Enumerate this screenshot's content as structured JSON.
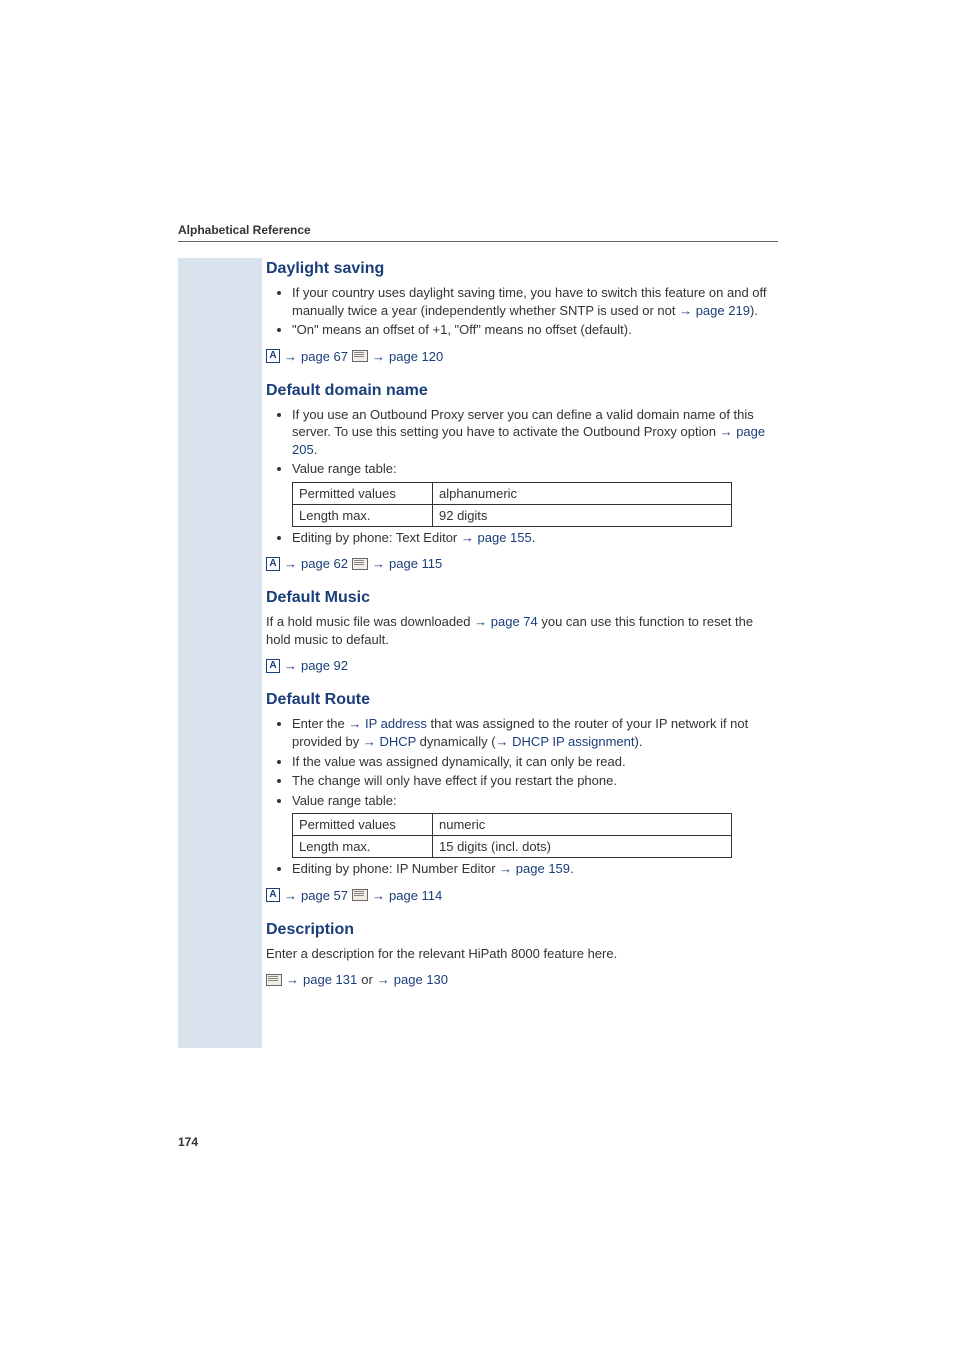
{
  "header": {
    "title": "Alphabetical Reference"
  },
  "page_number": "174",
  "sec1": {
    "title": "Daylight saving",
    "b1_a": "If your country uses daylight saving time, you have to switch this feature on and off manually twice a year (independently whether SNTP is used or not ",
    "b1_link": "page 219",
    "b1_b": ").",
    "b2": "\"On\" means an offset of +1, \"Off\" means no offset (default).",
    "ref1": "page 67",
    "ref2": "page 120"
  },
  "sec2": {
    "title": "Default domain name",
    "b1_a": "If you use an Outbound Proxy server you can define a valid domain name of this server. To use this setting you have to activate the Outbound Proxy option ",
    "b1_link": "page 205",
    "b1_b": ".",
    "b2": "Value range table:",
    "t_r1c1": "Permitted values",
    "t_r1c2": "alphanumeric",
    "t_r2c1": "Length max.",
    "t_r2c2": "92 digits",
    "b3_a": "Editing by phone: Text Editor ",
    "b3_link": "page 155",
    "b3_b": ".",
    "ref1": "page 62",
    "ref2": "page 115"
  },
  "sec3": {
    "title": "Default Music",
    "p_a": "If a hold music file was downloaded ",
    "p_link": "page 74",
    "p_b": " you can use this function to reset the hold music to default.",
    "ref1": "page 92"
  },
  "sec4": {
    "title": "Default Route",
    "b1_a": "Enter the ",
    "b1_link1": "IP address",
    "b1_mid": " that was assigned to the router of your IP network if not provided by ",
    "b1_link2": "DHCP",
    "b1_mid2": " dynamically (",
    "b1_link3": "DHCP IP assignment",
    "b1_b": ").",
    "b2": "If the value was assigned dynamically, it can only be read.",
    "b3": "The change will only have effect if you restart the phone.",
    "b4": "Value range table:",
    "t_r1c1": "Permitted values",
    "t_r1c2": "numeric",
    "t_r2c1": "Length max.",
    "t_r2c2": "15 digits (incl. dots)",
    "b5_a": "Editing by phone: IP Number Editor ",
    "b5_link": "page 159",
    "b5_b": ".",
    "ref1": "page 57",
    "ref2": "page 114"
  },
  "sec5": {
    "title": "Description",
    "p": "Enter a description for the relevant HiPath 8000 feature here.",
    "ref1": "page 131",
    "or": " or ",
    "ref2": "page 130"
  }
}
